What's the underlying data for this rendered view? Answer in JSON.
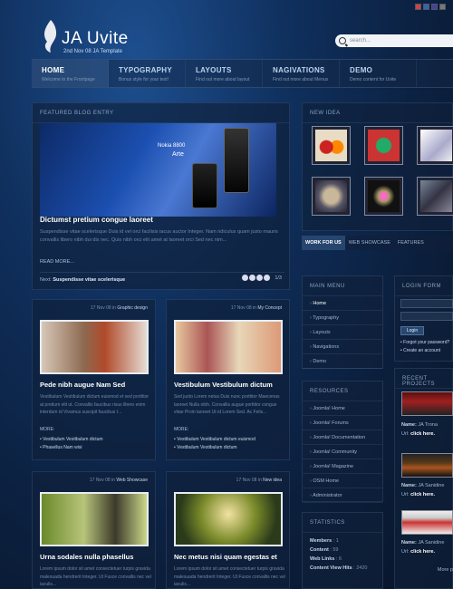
{
  "header": {
    "logo_title": "JA Uvite",
    "logo_sub": "2nd Nov 08 JA Template",
    "search_placeholder": "search..."
  },
  "nav": [
    {
      "label": "HOME",
      "sub": "Welcome to the Frontpage",
      "active": true
    },
    {
      "label": "TYPOGRAPHY",
      "sub": "Bonus style for your text!"
    },
    {
      "label": "LAYOUTS",
      "sub": "Find out more about layout"
    },
    {
      "label": "NAGIVATIONS",
      "sub": "Find out more about Menus"
    },
    {
      "label": "DEMO",
      "sub": "Demo content for Uvite"
    }
  ],
  "featured": {
    "heading": "FEATURED BLOG ENTRY",
    "image_text_1": "Nokia 8800",
    "image_text_2": "Arte",
    "title": "Dictumst pretium congue laoreet",
    "text": "Suspendisse vitae scelerisque Duis id vel orci facilisis iacus auctor Integer. Nam ridiculus quam justo mauris convallis libero nibh dui dis nec. Quis nibh orci elit amet at laoreet orci Sed nec nim...",
    "read_more": "READ MORE...",
    "next_label": "Next:",
    "next_title": "Suspendisse vitae scelerisque",
    "counter": "1/3"
  },
  "new_idea": {
    "heading": "NEW IDEA"
  },
  "tabs": [
    "WORK FOR US",
    "WEB SHOWCASE",
    "FEATURES"
  ],
  "articles": [
    {
      "date": "17 Nov 08 in",
      "category": "Graphic design",
      "title": "Pede nibh augue Nam Sed",
      "text": "Vestibulum Vestibulum dictum euismod et sed porttitor at pretium elit ut. Convallis faucibus risus libero enim interdum id Vivamus suscipit faucibus t...",
      "more": "MORE:",
      "links": [
        "Vestibulum Vestibulum dictum",
        "Phasellus Nam wisi"
      ]
    },
    {
      "date": "17 Nov 08 in",
      "category": "My Concept",
      "title": "Vestibulum Vestibulum dictum",
      "text": "Sed justo Lorem netus Duis nunc porttitor Maecenas laoreet Nulla nibh. Convallis augue porttitor congue vitae Proin laoreet Ut id Lorem Sed. Ac Felis...",
      "more": "MORE:",
      "links": [
        "Vestibulum Vestibulum dictum euismod",
        "Vestibulum Vestibulum dictum"
      ]
    },
    {
      "date": "17 Nov 08 in",
      "category": "Web Showcase",
      "title": "Urna sodales nulla phasellus",
      "text": "Lorem ipsum dolor sit amet consectetuer turpis gravida malesuada hendrerit Integer. Ut Fusce convallis nec vel iaculis..."
    },
    {
      "date": "17 Nov 08 in",
      "category": "New idea",
      "title": "Nec metus nisi quam egestas et",
      "text": "Lorem ipsum dolor sit amet consectetuer turpis gravida malesuada hendrerit Integer. Ut Fusce convallis nec vel iaculis..."
    }
  ],
  "main_menu": {
    "heading": "MAIN MENU",
    "items": [
      "Home",
      "Typography",
      "Layouts",
      "Navigations",
      "Demo"
    ]
  },
  "resources": {
    "heading": "RESOURCES",
    "items": [
      "Joomla! Home",
      "Joomla! Forums",
      "Joomla! Documentation",
      "Joomla! Community",
      "Joomla! Magazine",
      "OSM Home",
      "Administrator"
    ]
  },
  "statistics": {
    "heading": "STATISTICS",
    "rows": [
      {
        "label": "Members",
        "value": "1"
      },
      {
        "label": "Content",
        "value": "59"
      },
      {
        "label": "Web Links",
        "value": "6"
      },
      {
        "label": "Content View Hits",
        "value": "2420"
      }
    ]
  },
  "login": {
    "heading": "LOGIN FORM",
    "button": "Login",
    "forgot": "Forgot your password?",
    "create": "Create an account"
  },
  "recent": {
    "heading": "RECENT PROJECTS",
    "projects": [
      {
        "name_label": "Name:",
        "name": "JA Trona",
        "url_label": "Url:",
        "url": "click here."
      },
      {
        "name_label": "Name:",
        "name": "JA Sanidine",
        "url_label": "Url:",
        "url": "click here."
      },
      {
        "name_label": "Name:",
        "name": "JA Sanidine",
        "url_label": "Url:",
        "url": "click here."
      }
    ],
    "more": "More p"
  }
}
